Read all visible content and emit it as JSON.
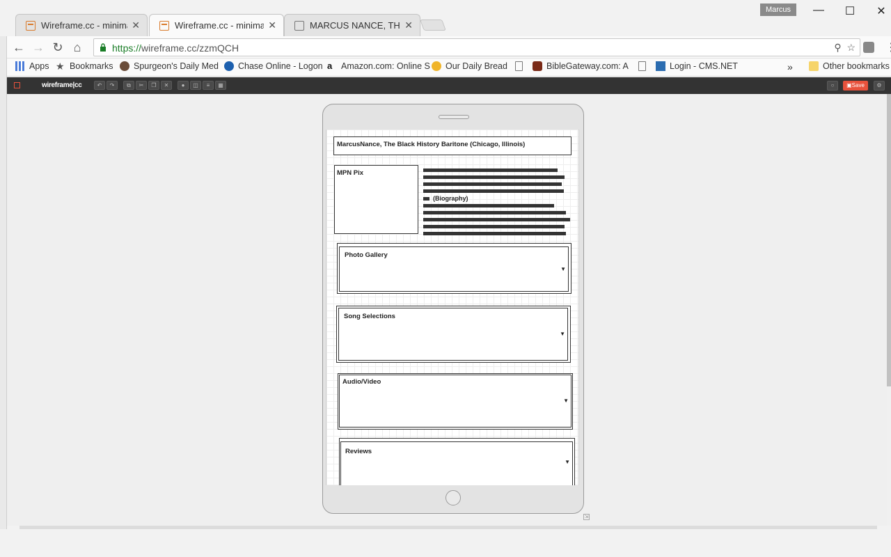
{
  "browser": {
    "profile_name": "Marcus",
    "tabs": [
      {
        "title": "Wireframe.cc - minimal w",
        "close": "✕"
      },
      {
        "title": "Wireframe.cc - minimal w",
        "close": "✕"
      },
      {
        "title": "MARCUS NANCE, THE BL",
        "close": "✕"
      }
    ],
    "url_scheme": "https://",
    "url_host": "wireframe.cc",
    "url_path": "/zzmQCH",
    "bookmarks": [
      {
        "label": "Apps"
      },
      {
        "label": "Bookmarks"
      },
      {
        "label": "Spurgeon's Daily Med"
      },
      {
        "label": "Chase Online - Logon"
      },
      {
        "label": "Amazon.com: Online S"
      },
      {
        "label": "Our Daily Bread"
      },
      {
        "label": ""
      },
      {
        "label": "BibleGateway.com: A"
      },
      {
        "label": ""
      },
      {
        "label": "Login - CMS.NET"
      }
    ],
    "bookmarks_overflow": "»",
    "other_bookmarks": "Other bookmarks"
  },
  "app": {
    "logo": "wireframe|cc",
    "save_label": "Save"
  },
  "wireframe": {
    "title_box": "MarcusNance, The Black History Baritone (Chicago, Illinois)",
    "pix_label": "MPN Pix",
    "bio_label": "(Biography)",
    "sections": [
      {
        "label": "Photo Gallery"
      },
      {
        "label": "Song Selections"
      },
      {
        "label": "Audio/Video"
      },
      {
        "label": "Reviews"
      }
    ],
    "dropdown_glyph": "▼"
  },
  "colors": {
    "accent": "#e8523c",
    "appbar": "#333333",
    "secure_url": "#1a7d27"
  }
}
